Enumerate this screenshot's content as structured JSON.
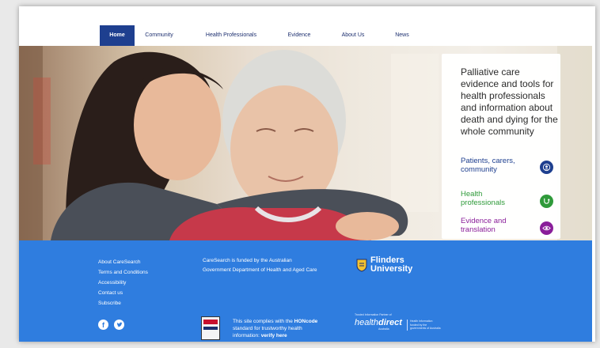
{
  "nav": {
    "items": [
      {
        "label": "Home",
        "active": true
      },
      {
        "label": "Community",
        "active": false
      },
      {
        "label": "Health Professionals",
        "active": false
      },
      {
        "label": "Evidence",
        "active": false
      },
      {
        "label": "About Us",
        "active": false
      },
      {
        "label": "News",
        "active": false
      }
    ]
  },
  "hero": {
    "image_alt": "young woman hugging elderly woman"
  },
  "card": {
    "intro": "Palliative care evidence and tools for health professionals and information about death and dying for the whole community",
    "links": [
      {
        "label": "Patients, carers, community",
        "color": "#1e3f8f",
        "icon": "people-icon"
      },
      {
        "label": "Health professionals",
        "color": "#2f9a3a",
        "icon": "stethoscope-icon"
      },
      {
        "label": "Evidence and translation",
        "color": "#8a1e9a",
        "icon": "eye-icon"
      }
    ]
  },
  "footer": {
    "links": [
      "About CareSearch",
      "Terms and Conditions",
      "Accessibility",
      "Contact us",
      "Subscribe"
    ],
    "funding_line1": "CareSearch is funded by the Australian",
    "funding_line2": "Government Department of Health and Aged Care",
    "university_line1": "Flinders",
    "university_line2": "University",
    "hon_line1_pre": "This site complies with the ",
    "hon_line1_bold": "HONcode",
    "hon_line2": "standard for trustworthy health",
    "hon_line3_pre": "information: ",
    "hon_line3_link": "verify here",
    "healthdirect_tag": "Trusted Information Partner of",
    "healthdirect_logo_a": "health",
    "healthdirect_logo_b": "direct",
    "healthdirect_sub": "Australia",
    "healthdirect_side": "Health information funded by the governments of Australia",
    "social": [
      "facebook-icon",
      "twitter-icon"
    ]
  },
  "colors": {
    "nav_active": "#1e3f8f",
    "footer_bg": "#2f7ddf",
    "text_dark": "#2b2b2b"
  }
}
